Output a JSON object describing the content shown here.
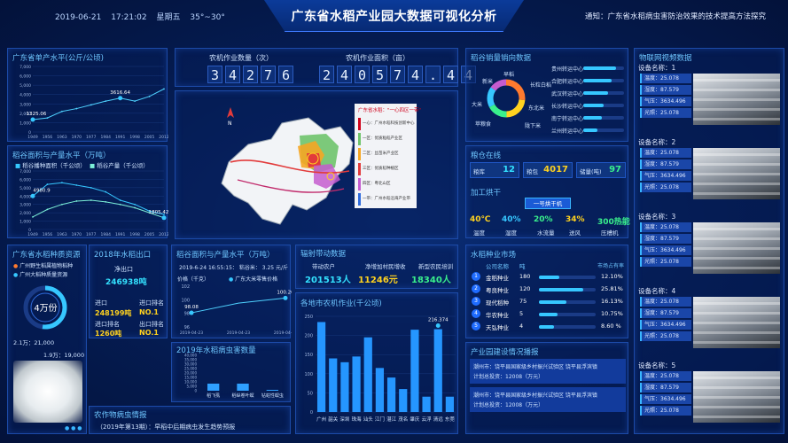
{
  "header": {
    "date": "2019-06-21",
    "time": "17:21:02",
    "weekday": "星期五",
    "temp": "35°~30°",
    "title": "广东省水稻产业园大数据可视化分析",
    "notice": "通知：广东省水稻病虫害防治效果的技术提高方法探究"
  },
  "yield_panel": {
    "title": "广东省单产水平(公斤/公顷)",
    "chart_data": {
      "type": "line",
      "x": [
        1949,
        1956,
        1963,
        1970,
        1977,
        1984,
        1991,
        1998,
        2005,
        2012
      ],
      "xlabels": [
        "1949",
        "1956",
        "1963",
        "1970",
        "1977",
        "1984",
        "1991",
        "1998",
        "2005",
        "2012"
      ],
      "values": [
        1325,
        1500,
        2200,
        2500,
        2900,
        3300,
        3616,
        3300,
        3800,
        4600
      ],
      "yticks": [
        "7,000",
        "6,000",
        "5,000",
        "4,000",
        "3,000",
        "2,000",
        "1,000",
        "0"
      ],
      "ylim": [
        0,
        7000
      ],
      "annotations": [
        {
          "label": "1325.06"
        },
        {
          "label": "3616.64"
        }
      ]
    }
  },
  "area_panel": {
    "title": "稻谷面积与产量水平（万吨）",
    "legend": [
      "稻谷播种面积（千公顷）",
      "稻谷产量（千公顷）"
    ],
    "chart_data": {
      "type": "line",
      "xlabels": [
        "1949",
        "1956",
        "1963",
        "1970",
        "1977",
        "1984",
        "1991",
        "1998",
        "2005",
        "2012"
      ],
      "yticks": [
        "7,000",
        "6,000",
        "5,000",
        "4,000",
        "3,000",
        "2,000",
        "1,000",
        "0"
      ],
      "ylim": [
        0,
        7000
      ],
      "series": [
        {
          "name": "稻谷播种面积（千公顷）",
          "values": [
            4000,
            5400,
            5600,
            5300,
            5000,
            4500,
            3500,
            3000,
            2200,
            1806
          ]
        },
        {
          "name": "稻谷产量（千公顷）",
          "values": [
            1500,
            2400,
            3000,
            3400,
            3500,
            3300,
            3000,
            2600,
            2000,
            1400
          ]
        }
      ],
      "annotations": [
        {
          "label": "4980.9"
        },
        {
          "label": "1805.42"
        }
      ]
    }
  },
  "quality_panel": {
    "title": "广东省水稻种质资源",
    "legend": [
      "广州野生稻属植物稻种",
      "广州大稻种质量资源"
    ],
    "donut_value": "4万份",
    "label_1": "2.1万：21,000",
    "label_2": "1.9万：19,000"
  },
  "export_panel": {
    "title": "2018年水稻出口",
    "net_label": "净出口",
    "net_value": "246938吨",
    "import_label": "进口",
    "import_value": "248199吨",
    "import_rank_label": "进口排名",
    "import_rank": "NO.1",
    "iexp_label": "进口排名",
    "iexp_value": "1260吨",
    "exp_rank_label": "出口排名",
    "exp_rank": "NO.1"
  },
  "center_top": {
    "work_count_label": "农机作业数量（次）",
    "work_count": [
      "3",
      "4",
      "2",
      "7",
      "6"
    ],
    "work_area_label": "农机作业面积（亩）",
    "work_area": [
      "2",
      "4",
      "0",
      "5",
      "7",
      "4",
      ".",
      "4",
      "4"
    ]
  },
  "map_panel": {
    "legend_title": "广东省水稻：\"一心四区一带\"",
    "legend_items": [
      "一心：广州水稻科技创新中心",
      "一区：优质籼稻产业区",
      "二区：丝苗米产业区",
      "三区：优质稻种植区",
      "四区：粤北山区",
      "一带：广州水稻沿海产业带"
    ]
  },
  "price_panel": {
    "title": "稻谷面积与产量水平（万吨）",
    "stamp": "2019-6-24  16:55:15：   粘谷米：  3.25  元/斤",
    "ylabel": "价格（千克）",
    "legend": "广东大米零售价格",
    "chart_data": {
      "type": "line",
      "x": [
        "2019-04-23",
        "2019-04-23",
        "2019-04-23"
      ],
      "values": [
        98.08,
        99.5,
        100.26
      ],
      "yticks": [
        "102",
        "100",
        "98",
        "96"
      ],
      "ylim": [
        96,
        102
      ],
      "annotations": [
        {
          "label": "98.08"
        },
        {
          "label": "100.26"
        }
      ]
    }
  },
  "pest_panel": {
    "title": "2019年水稻病虫害数量",
    "chart_data": {
      "type": "bar",
      "categories": [
        "稻飞虱",
        "稻纵卷叶螟",
        "钻蛀性螟虫"
      ],
      "values": [
        8000,
        8000,
        1000
      ],
      "yticks": [
        "40,000",
        "35,000",
        "30,000",
        "25,000",
        "20,000",
        "15,000",
        "10,000",
        "5,000",
        "0"
      ],
      "ylim": [
        0,
        40000
      ]
    }
  },
  "radiation_panel": {
    "title": "辐射带动数据",
    "items": [
      {
        "label": "带动农户",
        "value": "201513人"
      },
      {
        "label": "净增加村民增收",
        "value": "11246元"
      },
      {
        "label": "新型农民培训",
        "value": "18340人"
      }
    ]
  },
  "city_bars_panel": {
    "title": "各地市农机作业(千公顷)",
    "chart_data": {
      "type": "bar",
      "categories": [
        "广州",
        "韶关",
        "深圳",
        "珠海",
        "汕头",
        "江门",
        "湛江",
        "茂名",
        "肇庆",
        "云浮",
        "清远",
        "东莞"
      ],
      "values": [
        235,
        140,
        130,
        145,
        195,
        115,
        90,
        60,
        215,
        40,
        216.374,
        40
      ],
      "yticks": [
        "250",
        "200",
        "150",
        "100",
        "50",
        "0"
      ],
      "ylim": [
        0,
        250
      ],
      "annotation": "216.374"
    }
  },
  "flow_panel": {
    "title": "稻谷销量销向数据",
    "left_labels": [
      "新米",
      "大米",
      "苹粮食",
      "早稻"
    ],
    "items": [
      {
        "label": "贵州转运中心",
        "value": 0.8
      },
      {
        "label": "合肥转运中心",
        "value": 0.7
      },
      {
        "label": "武汉转运中心",
        "value": 0.6
      },
      {
        "label": "长沙转运中心",
        "value": 0.5
      },
      {
        "label": "南宁转运中心",
        "value": 0.45
      },
      {
        "label": "兰州转运中心",
        "value": 0.35
      }
    ],
    "donut_labels": [
      "长粒白稻",
      "东北米",
      "陇下米"
    ]
  },
  "grain_panel": {
    "title": "粮仓在线",
    "items": [
      {
        "label": "粮库",
        "value": "12"
      },
      {
        "label": "粮包",
        "value": "4017"
      },
      {
        "label": "储量(吨)",
        "value": "97"
      }
    ],
    "dryer_title": "加工烘干",
    "dryer_btn": "一号烘干机",
    "metrics": [
      {
        "value": "40℃",
        "label": "温度"
      },
      {
        "value": "40%",
        "label": "湿度"
      },
      {
        "value": "20%",
        "label": "水流量"
      },
      {
        "value": "34%",
        "label": "送风"
      },
      {
        "value": "300热能",
        "label": "压槽机"
      }
    ]
  },
  "market_panel": {
    "title": "水稻种业市场",
    "head": [
      "公司名称",
      "吨",
      "市场占有率"
    ],
    "rows": [
      {
        "rank": "1",
        "name": "金稻种业",
        "qty": "180",
        "share": "12.10%"
      },
      {
        "rank": "2",
        "name": "粤良种业",
        "qty": "120",
        "share": "25.81%"
      },
      {
        "rank": "3",
        "name": "现代稻种",
        "qty": "75",
        "share": "16.13%"
      },
      {
        "rank": "4",
        "name": "华农种业",
        "qty": "5",
        "share": "10.75%"
      },
      {
        "rank": "5",
        "name": "天弘种业",
        "qty": "4",
        "share": "8.60 %"
      }
    ]
  },
  "project_panel": {
    "title": "产业园建设情况播报",
    "lines": [
      "潮州市：饶平县国家级乡村振兴试验区 饶平县浮滨镇",
      "计划总投资：12008（万元）",
      "潮州市：饶平县国家级乡村振兴试验区 饶平县浮滨镇",
      "计划总投资：12008（万元）"
    ]
  },
  "camera_panel": {
    "title": "物联网视频数据",
    "devices": [
      {
        "name": "设备名称：1",
        "tags": [
          "温度：25.078",
          "湿度：87.579",
          "气压：3634.496",
          "光照：25.078"
        ]
      },
      {
        "name": "设备名称：2",
        "tags": [
          "温度：25.078",
          "湿度：87.579",
          "气压：3634.496",
          "光照：25.078"
        ]
      },
      {
        "name": "设备名称：3",
        "tags": [
          "温度：25.078",
          "湿度：87.579",
          "气压：3634.496",
          "光照：25.078"
        ]
      },
      {
        "name": "设备名称：4",
        "tags": [
          "温度：25.078",
          "湿度：87.579",
          "气压：3634.496",
          "光照：25.078"
        ]
      },
      {
        "name": "设备名称：5",
        "tags": [
          "温度：25.078",
          "湿度：87.579",
          "气压：3634.496",
          "光照：25.078"
        ]
      }
    ]
  },
  "ticker_panel": {
    "title": "农作物病虫情报",
    "text": "（2019年第13期）：早稻中后期病虫发生趋势预报"
  }
}
